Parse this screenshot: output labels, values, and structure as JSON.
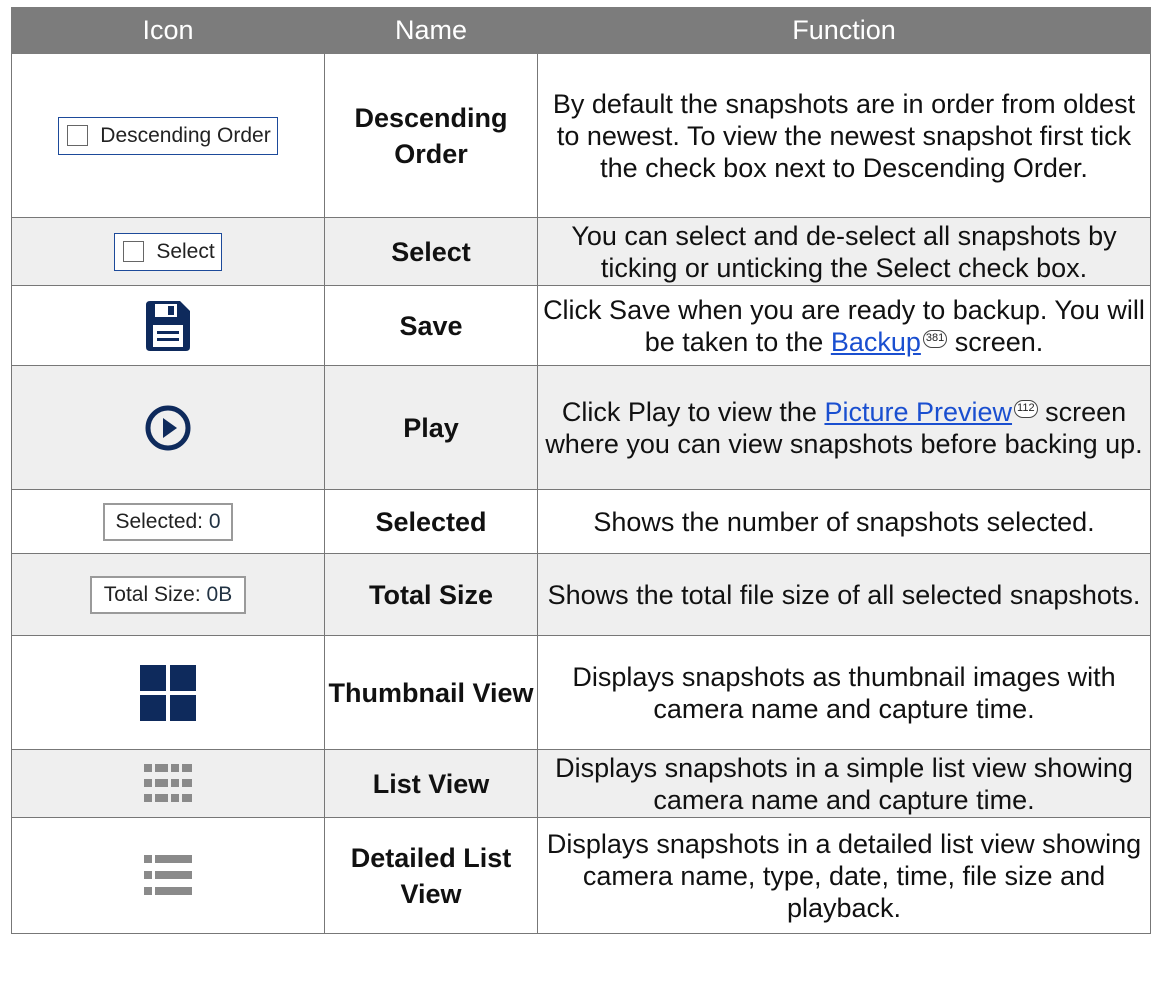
{
  "table": {
    "headers": [
      "Icon",
      "Name",
      "Function"
    ],
    "rows": [
      {
        "icon": "descending-order-checkbox",
        "icon_text": "Descending Order",
        "name": "Descending Order",
        "function": "By default the snapshots are in order from oldest to newest. To view the newest snapshot first tick the check box next to Descending Order."
      },
      {
        "icon": "select-checkbox",
        "icon_text": "Select",
        "name": "Select",
        "function": "You can select and de-select all snapshots by ticking or unticking the Select check box."
      },
      {
        "icon": "save-icon",
        "name": "Save",
        "function_pre": "Click Save when you are ready to backup. You will be taken to the ",
        "function_link": "Backup",
        "function_ref": "381",
        "function_post": " screen."
      },
      {
        "icon": "play-icon",
        "name": "Play",
        "function_pre": "Click Play to view the ",
        "function_link": "Picture Preview",
        "function_ref": "112",
        "function_post": " screen where you can view snapshots before backing up."
      },
      {
        "icon": "selected-counter",
        "icon_label": "Selected:",
        "icon_value": "0",
        "name": "Selected",
        "function": "Shows the number of snapshots selected."
      },
      {
        "icon": "total-size-counter",
        "icon_label": "Total Size:",
        "icon_value": "0B",
        "name": "Total Size",
        "function": "Shows the total file size of all selected snapshots."
      },
      {
        "icon": "thumbnail-view-icon",
        "name": "Thumbnail View",
        "function": "Displays snapshots as thumbnail images with camera name and capture time."
      },
      {
        "icon": "list-view-icon",
        "name": "List View",
        "function": "Displays snapshots in a simple list view showing camera name and capture time."
      },
      {
        "icon": "detailed-list-view-icon",
        "name": "Detailed List View",
        "function": "Displays snapshots in a detailed list view showing camera name, type, date, time, file size and playback."
      }
    ]
  },
  "colors": {
    "header_bg": "#7c7c7c",
    "alt_row_bg": "#efefef",
    "icon_navy": "#0e2a5c",
    "icon_gray": "#8a8a8a",
    "link": "#1a4fd0"
  }
}
